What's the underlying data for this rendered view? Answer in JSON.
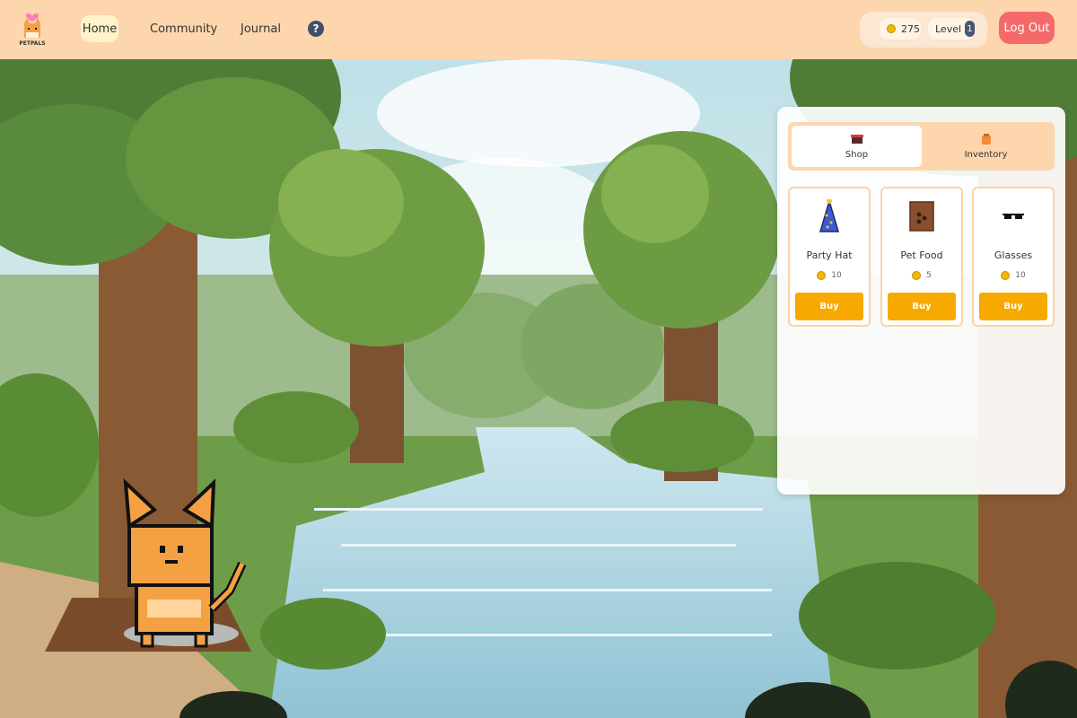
{
  "brand": {
    "logo_text": "PETPALS"
  },
  "nav": {
    "home": "Home",
    "community": "Community",
    "journal": "Journal",
    "help": "?"
  },
  "stats": {
    "coins": "275",
    "level_label": "Level",
    "level_value": "1"
  },
  "logout_label": "Log Out",
  "panel": {
    "tabs": [
      {
        "label": "Shop",
        "icon": "shop-icon"
      },
      {
        "label": "Inventory",
        "icon": "backpack-icon"
      }
    ],
    "active_tab": "Shop",
    "items": [
      {
        "name": "Party Hat",
        "price": "10",
        "buy_label": "Buy",
        "icon": "party-hat-icon"
      },
      {
        "name": "Pet Food",
        "price": "5",
        "buy_label": "Buy",
        "icon": "pet-food-icon"
      },
      {
        "name": "Glasses",
        "price": "10",
        "buy_label": "Buy",
        "icon": "glasses-icon"
      }
    ]
  },
  "colors": {
    "topbar": "#fdd6ad",
    "logout": "#f46a6a",
    "buy": "#f8a900",
    "accent_active": "#fff3c9"
  }
}
